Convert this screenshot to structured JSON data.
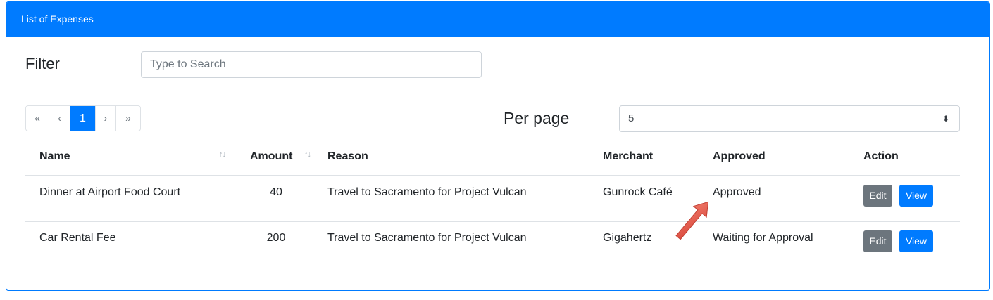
{
  "card": {
    "title": "List of Expenses"
  },
  "filter": {
    "label": "Filter",
    "placeholder": "Type to Search"
  },
  "pagination": {
    "first": "«",
    "prev": "‹",
    "current": "1",
    "next": "›",
    "last": "»"
  },
  "per_page": {
    "label": "Per page",
    "value": "5",
    "caret": "⬍"
  },
  "table": {
    "headers": {
      "name": "Name",
      "amount": "Amount",
      "reason": "Reason",
      "merchant": "Merchant",
      "approved": "Approved",
      "action": "Action"
    },
    "sort_icon": "↑↓",
    "rows": [
      {
        "name": "Dinner at Airport Food Court",
        "amount": "40",
        "reason": "Travel to Sacramento for Project Vulcan",
        "merchant": "Gunrock Café",
        "approved": "Approved",
        "edit": "Edit",
        "view": "View"
      },
      {
        "name": "Car Rental Fee",
        "amount": "200",
        "reason": "Travel to Sacramento for Project Vulcan",
        "merchant": "Gigahertz",
        "approved": "Waiting for Approval",
        "edit": "Edit",
        "view": "View"
      }
    ]
  },
  "annotation": {
    "arrow_color": "#e8574b"
  }
}
